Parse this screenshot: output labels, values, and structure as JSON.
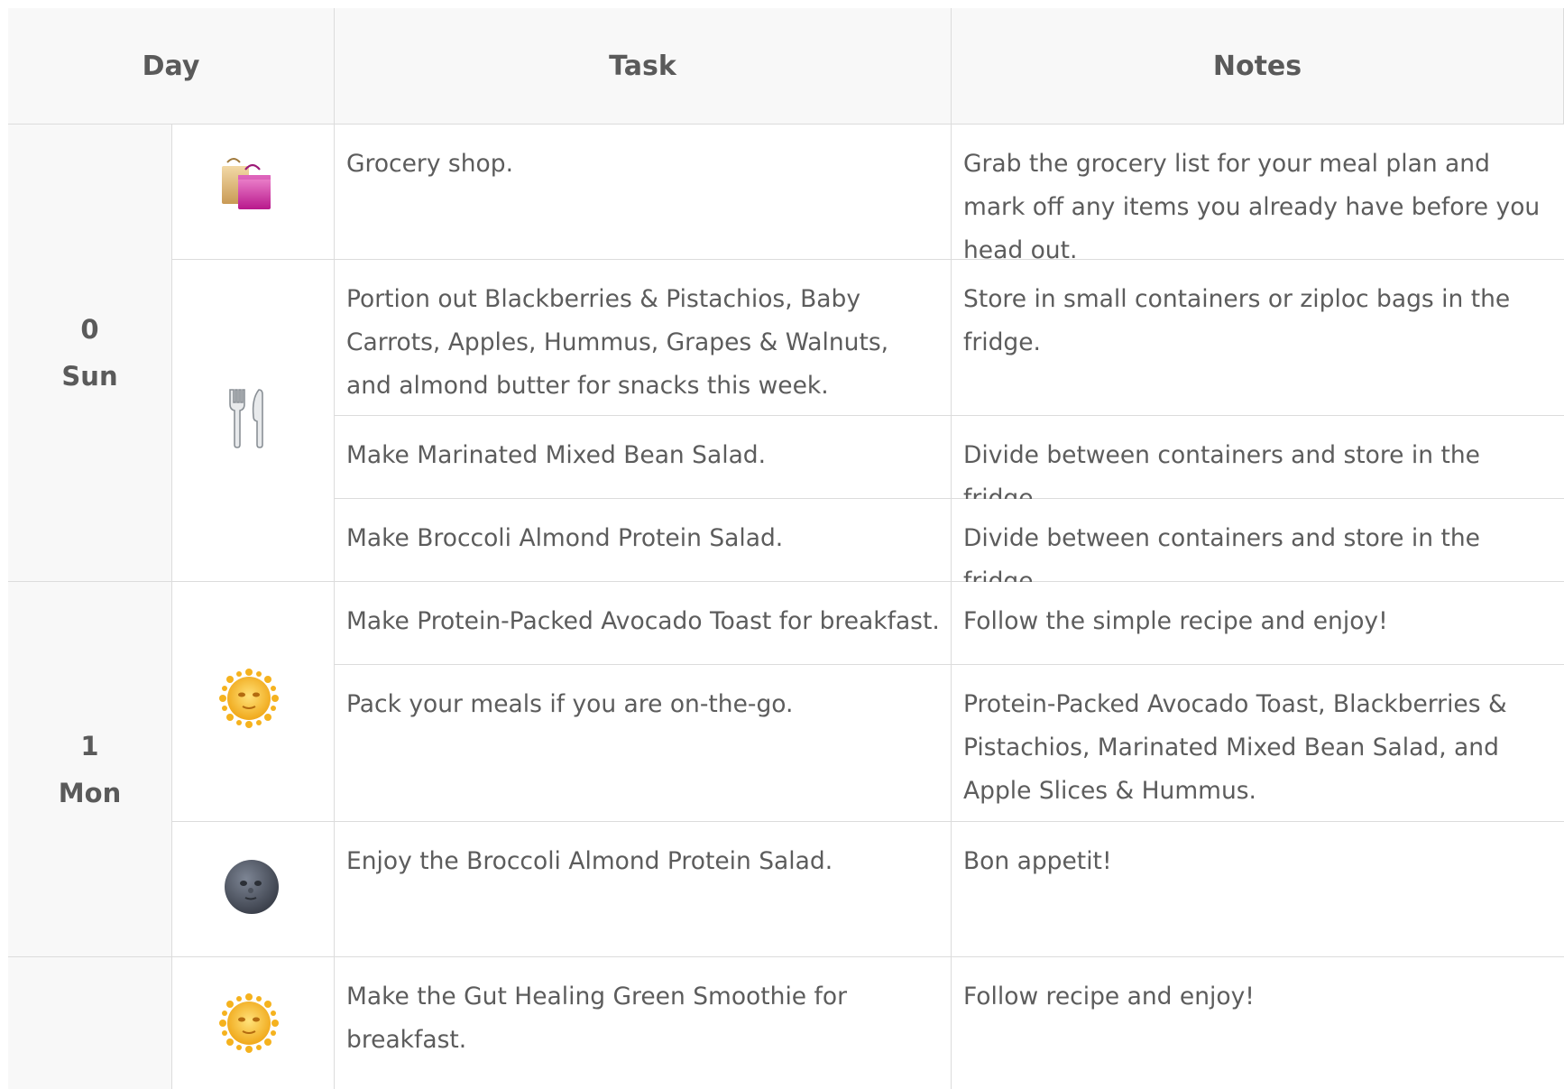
{
  "header": {
    "day_label": "Day",
    "task_label": "Task",
    "notes_label": "Notes"
  },
  "days": [
    {
      "number": "0",
      "name": "Sun"
    },
    {
      "number": "1",
      "name": "Mon"
    }
  ],
  "icons": {
    "shopping": "shopping-bags-icon",
    "meal": "fork-and-knife-icon",
    "morning": "sun-with-face-icon",
    "evening": "new-moon-face-icon"
  },
  "rows": [
    {
      "task": "Grocery shop.",
      "notes": "Grab the grocery list for your meal plan and mark off any items you already have before you head out."
    },
    {
      "task": "Portion out Blackberries & Pistachios, Baby Carrots, Apples, Hummus, Grapes & Walnuts, and almond butter for snacks this week.",
      "notes": "Store in small containers or ziploc bags in the fridge."
    },
    {
      "task": "Make Marinated Mixed Bean Salad.",
      "notes": "Divide between containers and store in the fridge."
    },
    {
      "task": "Make Broccoli Almond Protein Salad.",
      "notes": "Divide between containers and store in the fridge."
    },
    {
      "task": "Make Protein-Packed Avocado Toast for breakfast.",
      "notes": "Follow the simple recipe and enjoy!"
    },
    {
      "task": "Pack your meals if you are on-the-go.",
      "notes": "Protein-Packed Avocado Toast, Blackberries & Pistachios, Marinated Mixed Bean Salad, and Apple Slices & Hummus."
    },
    {
      "task": "Enjoy the Broccoli Almond Protein Salad.",
      "notes": "Bon appetit!"
    },
    {
      "task": "Make the Gut Healing Green Smoothie for breakfast.",
      "notes": "Follow recipe and enjoy!"
    }
  ]
}
